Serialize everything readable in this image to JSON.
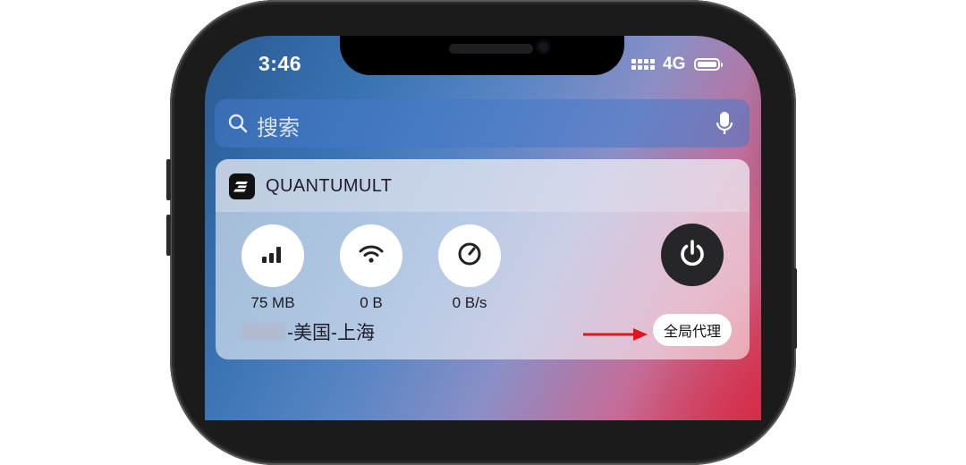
{
  "status_bar": {
    "time": "3:46",
    "carrier": "4G"
  },
  "search": {
    "placeholder": "搜索",
    "icon": "search-icon",
    "mic_icon": "microphone-icon"
  },
  "widget": {
    "app_name": "QUANTUMULT",
    "stats": [
      {
        "icon": "cellular-bars-icon",
        "value": "75 MB"
      },
      {
        "icon": "wifi-icon",
        "value": "0 B"
      },
      {
        "icon": "speedometer-icon",
        "value": "0 B/s"
      }
    ],
    "power_icon": "power-icon",
    "server_label": "-美国-上海",
    "mode_label": "全局代理"
  },
  "annotation": {
    "arrow_color": "#e3141b"
  },
  "colors": {
    "power_button": "#262629",
    "arrow": "#e3141b"
  }
}
